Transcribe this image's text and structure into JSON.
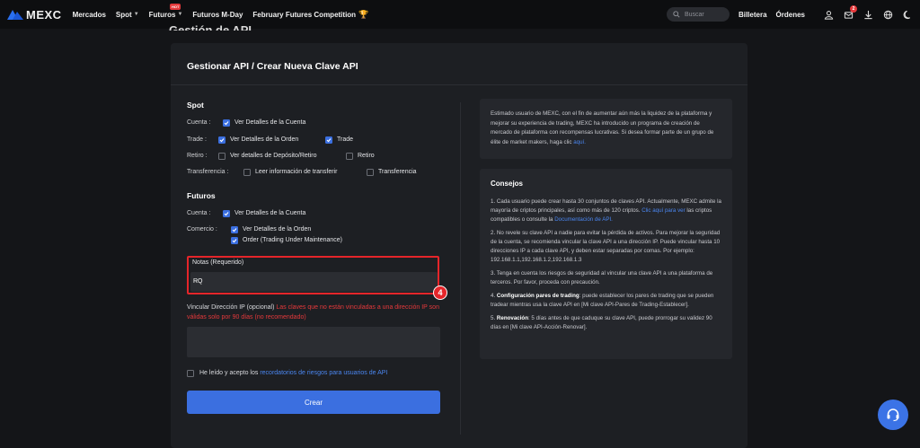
{
  "nav": {
    "logo_text": "MEXC",
    "items": [
      {
        "label": "Mercados",
        "caret": false
      },
      {
        "label": "Spot",
        "caret": true
      },
      {
        "label": "Futuros",
        "caret": true,
        "badge": "HOT"
      },
      {
        "label": "Futuros M-Day",
        "caret": false
      },
      {
        "label": "February Futures Competition",
        "caret": false,
        "icon": "trophy-icon"
      }
    ],
    "search_placeholder": "Buscar",
    "wallet_label": "Billetera",
    "orders_label": "Órdenes",
    "notification_count": "2"
  },
  "page": {
    "hidden_title": "Gestión de API"
  },
  "card": {
    "title": "Gestionar API / Crear Nueva Clave API",
    "spot": {
      "heading": "Spot",
      "rows": [
        {
          "label": "Cuenta :",
          "options": [
            {
              "text": "Ver Detalles de la Cuenta",
              "checked": true
            }
          ]
        },
        {
          "label": "Trade :",
          "options": [
            {
              "text": "Ver Detalles de la Orden",
              "checked": true
            },
            {
              "text": "Trade",
              "checked": true
            }
          ]
        },
        {
          "label": "Retiro :",
          "options": [
            {
              "text": "Ver detalles de Depósito/Retiro",
              "checked": false
            },
            {
              "text": "Retiro",
              "checked": false
            }
          ]
        },
        {
          "label": "Transferencia :",
          "options": [
            {
              "text": "Leer información de transferir",
              "checked": false
            },
            {
              "text": "Transferencia",
              "checked": false
            }
          ]
        }
      ]
    },
    "futures": {
      "heading": "Futuros",
      "rows": [
        {
          "label": "Cuenta :",
          "options": [
            {
              "text": "Ver Detalles de la Cuenta",
              "checked": true
            }
          ]
        },
        {
          "label": "Comercio :",
          "options": [
            {
              "text": "Ver Detalles de la Orden",
              "checked": true
            },
            {
              "text": "Order (Trading Under Maintenance)",
              "checked": true
            }
          ]
        }
      ]
    },
    "notes": {
      "label": "Notas (Requerido)",
      "value": "RQ"
    },
    "marker": "4",
    "ip": {
      "label": "Vincular Dirección IP (opcional)",
      "warning": "Las claves que no están vinculadas a una dirección IP son válidas solo por 90 días (no recomendado)",
      "value": ""
    },
    "agree": {
      "text": "He leído y acepto los",
      "link": "recordatorios de riesgos para usuarios de API",
      "checked": false
    },
    "create_label": "Crear"
  },
  "info": {
    "text": "Estimado usuario de MEXC, con el fin de aumentar aún más la liquidez de la plataforma y mejorar su experiencia de trading, MEXC ha introducido un programa de creación de mercado de plataforma con recompensas lucrativas. Si desea formar parte de un grupo de élite de market makers, haga clic",
    "link": "aquí."
  },
  "tips": {
    "title": "Consejos",
    "t1_text": "1. Cada usuario puede crear hasta 30 conjuntos de claves API. Actualmente, MEXC admite la mayoría de criptos principales, así como más de 120 criptos.",
    "t1_link1": "Clic aquí para ver",
    "t1_mid": "las criptos compatibles o consulte la",
    "t1_link2": "Documentación de API.",
    "t2": "2. No revele su clave API a nadie para evitar la pérdida de activos. Para mejorar la seguridad de la cuenta, se recomienda vincular la clave API a una dirección IP. Puede vincular hasta 10 direcciones IP a cada clave API, y deben estar separadas por comas. Por ejemplo: 192.168.1.1,192.168.1.2,192.168.1.3",
    "t3": "3. Tenga en cuenta los riesgos de seguridad al vincular una clave API a una plataforma de terceros. Por favor, proceda con precaución.",
    "t4_num": "4.",
    "t4_bold": "Configuración pares de trading",
    "t4_text": ": puede establecer los pares de trading que se pueden tradear mientras usa la clave API en [Mi clave API-Pares de Trading-Establecer].",
    "t5_num": "5.",
    "t5_bold": "Renovación",
    "t5_text": ": 5 días antes de que caduque su clave API, puede prorrogar su validez 90 días en [Mi clave API-Acción-Renovar]."
  },
  "colors": {
    "accent": "#3b6fe0",
    "warning": "#e5393b",
    "highlight": "#e5252a"
  }
}
